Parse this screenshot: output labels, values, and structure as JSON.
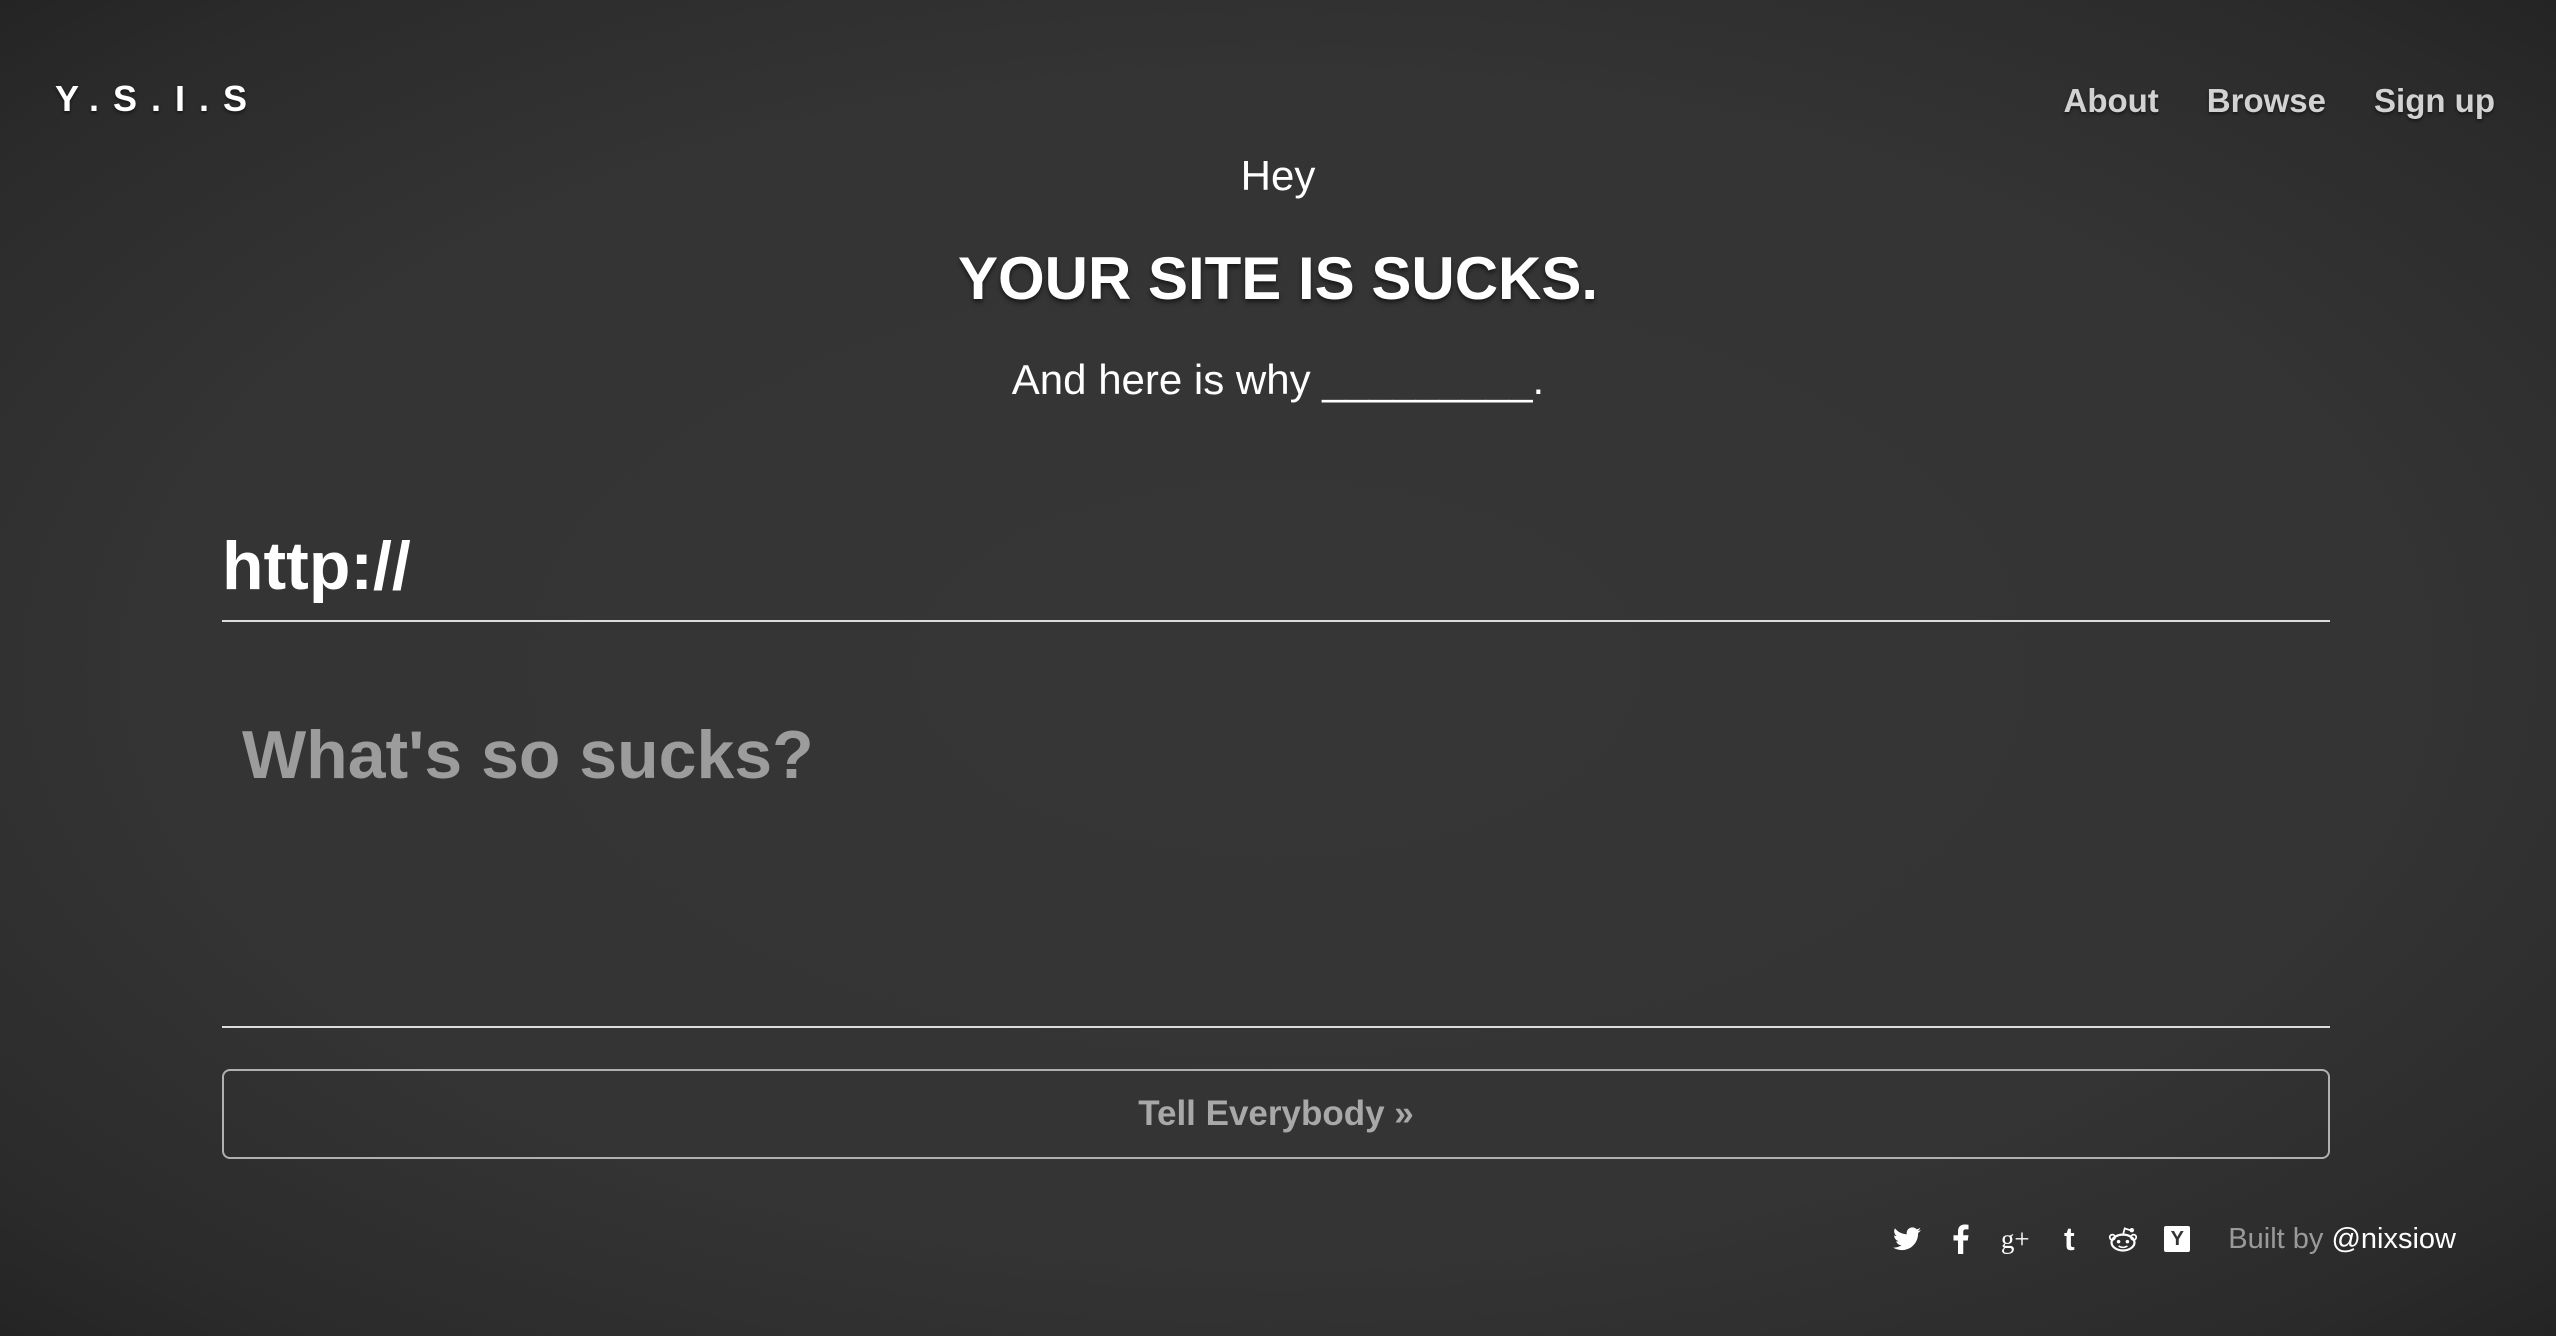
{
  "header": {
    "logo": "Y.S.I.S",
    "nav": {
      "about": "About",
      "browse": "Browse",
      "signup": "Sign up"
    }
  },
  "hero": {
    "greeting": "Hey",
    "headline": "YOUR SITE IS SUCKS.",
    "subline": "And here is why _________."
  },
  "form": {
    "url_value": "http://",
    "comment_placeholder": "What's so sucks?",
    "submit_label": "Tell Everybody »"
  },
  "footer": {
    "social_icons": [
      "twitter-icon",
      "facebook-icon",
      "google-plus-icon",
      "tumblr-icon",
      "reddit-icon",
      "hacker-news-icon"
    ],
    "built_by_text": "Built by",
    "built_by_handle": "@nixsiow"
  },
  "colors": {
    "background": "#343434",
    "nav_text": "#d2d2d2",
    "placeholder": "#9c9c9c",
    "button_text": "#a8a8a8"
  }
}
